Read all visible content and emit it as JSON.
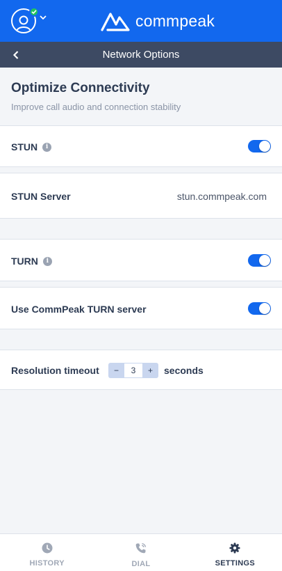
{
  "brand": {
    "name": "commpeak"
  },
  "header": {
    "title": "Network Options"
  },
  "intro": {
    "title": "Optimize Connectivity",
    "subtitle": "Improve call audio and connection stability"
  },
  "settings": {
    "stun": {
      "label": "STUN",
      "enabled": true
    },
    "stun_server": {
      "label": "STUN Server",
      "value": "stun.commpeak.com"
    },
    "turn": {
      "label": "TURN",
      "enabled": true
    },
    "use_turn": {
      "label": "Use CommPeak TURN server",
      "enabled": true
    },
    "resolution_timeout": {
      "label": "Resolution timeout",
      "value": "3",
      "decrement": "−",
      "increment": "+",
      "unit": "seconds"
    }
  },
  "nav": {
    "items": [
      {
        "label": "HISTORY",
        "icon": "clock-icon",
        "active": false
      },
      {
        "label": "DIAL",
        "icon": "phone-icon",
        "active": false
      },
      {
        "label": "SETTINGS",
        "icon": "gear-icon",
        "active": true
      }
    ]
  },
  "colors": {
    "primary": "#1268ee",
    "header_dark": "#3d4a63",
    "status_online": "#22c55e"
  }
}
